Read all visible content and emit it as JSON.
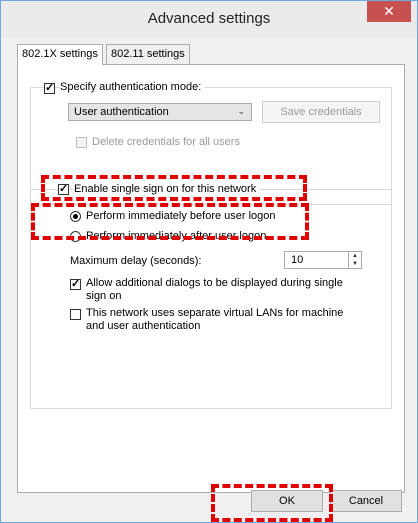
{
  "window": {
    "title": "Advanced settings",
    "close_glyph": "✕"
  },
  "tabs": [
    {
      "label": "802.1X settings",
      "active": true
    },
    {
      "label": "802.11 settings",
      "active": false
    }
  ],
  "auth": {
    "specify_label": "Specify authentication mode:",
    "specify_checked": true,
    "mode_value": "User authentication",
    "save_credentials_label": "Save credentials",
    "delete_credentials_label": "Delete credentials for all users",
    "delete_checked": false
  },
  "sso": {
    "enable_label": "Enable single sign on for this network",
    "enable_checked": true,
    "option_before_label": "Perform immediately before user logon",
    "option_after_label": "Perform immediately after user logon",
    "selected_option": "before",
    "max_delay_label": "Maximum delay (seconds):",
    "max_delay_value": "10",
    "allow_dialogs_label_1": "Allow additional dialogs to be displayed during single",
    "allow_dialogs_label_2": "sign on",
    "allow_dialogs_checked": true,
    "separate_vlans_label_1": "This network uses separate virtual LANs for machine",
    "separate_vlans_label_2": "and user authentication",
    "separate_vlans_checked": false
  },
  "footer": {
    "ok_label": "OK",
    "cancel_label": "Cancel"
  },
  "annotation_color": "#e00000"
}
